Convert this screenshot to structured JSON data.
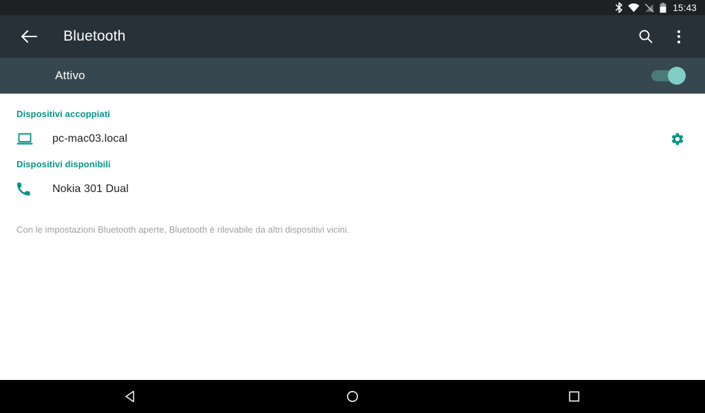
{
  "status_bar": {
    "icons": [
      "bluetooth-icon",
      "wifi-icon",
      "no-sim-icon",
      "battery-icon"
    ],
    "clock": "15:43"
  },
  "toolbar": {
    "back_label": "back-arrow",
    "title": "Bluetooth",
    "search_label": "search-icon",
    "overflow_label": "more-options-icon"
  },
  "switch_bar": {
    "label": "Attivo",
    "state": "on"
  },
  "sections": [
    {
      "header": "Dispositivi accoppiati",
      "devices": [
        {
          "name": "pc-mac03.local",
          "icon": "laptop-icon",
          "has_settings": true
        }
      ]
    },
    {
      "header": "Dispositivi disponibili",
      "devices": [
        {
          "name": "Nokia 301 Dual",
          "icon": "phone-icon",
          "has_settings": false
        }
      ]
    }
  ],
  "footer": {
    "note": "Con le impostazioni Bluetooth aperte, Bluetooth è rilevabile da altri dispositivi vicini."
  },
  "nav_bar": {
    "back": "nav-back-icon",
    "home": "nav-home-icon",
    "recents": "nav-recents-icon"
  },
  "colors": {
    "accent_teal": "#009688",
    "status_bar_bg": "#1d2124",
    "toolbar_bg": "#263238",
    "switch_bar_bg": "#37474f",
    "switch_thumb": "#7fcdc4",
    "content_bg": "#ffffff",
    "nav_bar_bg": "#000000"
  }
}
